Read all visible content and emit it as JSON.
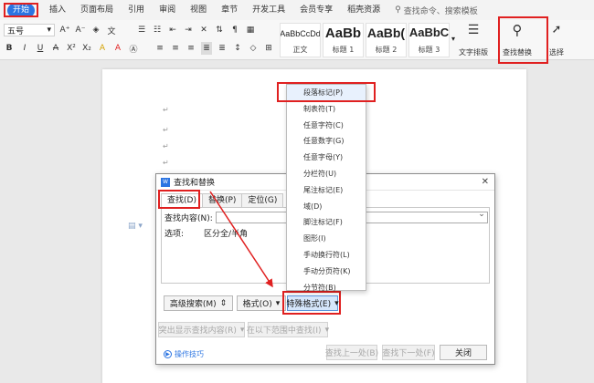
{
  "ribbon": {
    "tabs": [
      "开始",
      "插入",
      "页面布局",
      "引用",
      "审阅",
      "视图",
      "章节",
      "开发工具",
      "会员专享",
      "稻壳资源"
    ],
    "search_placeholder": "查找命令、搜索模板"
  },
  "toolbar": {
    "font_size": "五号",
    "styles": [
      {
        "sample": "AaBbCcDd",
        "name": "正文"
      },
      {
        "sample": "AaBb",
        "name": "标题 1"
      },
      {
        "sample": "AaBb(",
        "name": "标题 2"
      },
      {
        "sample": "AaBbC",
        "name": "标题 3"
      }
    ],
    "text_layout_label": "文字排版",
    "find_replace_label": "查找替换",
    "select_label": "选择"
  },
  "dialog": {
    "title": "查找和替换",
    "tabs": [
      "查找(D)",
      "替换(P)",
      "定位(G)"
    ],
    "find_label": "查找内容(N):",
    "find_value": "",
    "options_label": "选项:",
    "options_value": "区分全/半角",
    "advanced_search": "高级搜索(M)",
    "format": "格式(O)",
    "special_format": "特殊格式(E)",
    "highlight_all": "突出显示查找内容(R)",
    "find_in": "在以下范围中查找(I)",
    "find_prev": "查找上一处(B)",
    "find_next": "查找下一处(F)",
    "close": "关闭",
    "tips": "操作技巧"
  },
  "special_menu": {
    "items": [
      "段落标记(P)",
      "制表符(T)",
      "任意字符(C)",
      "任意数字(G)",
      "任意字母(Y)",
      "分栏符(U)",
      "尾注标记(E)",
      "域(D)",
      "脚注标记(F)",
      "图形(I)",
      "手动换行符(L)",
      "手动分页符(K)",
      "分节符(B)"
    ]
  },
  "colors": {
    "accent": "#2b74e2",
    "highlight_box": "#e02020"
  }
}
